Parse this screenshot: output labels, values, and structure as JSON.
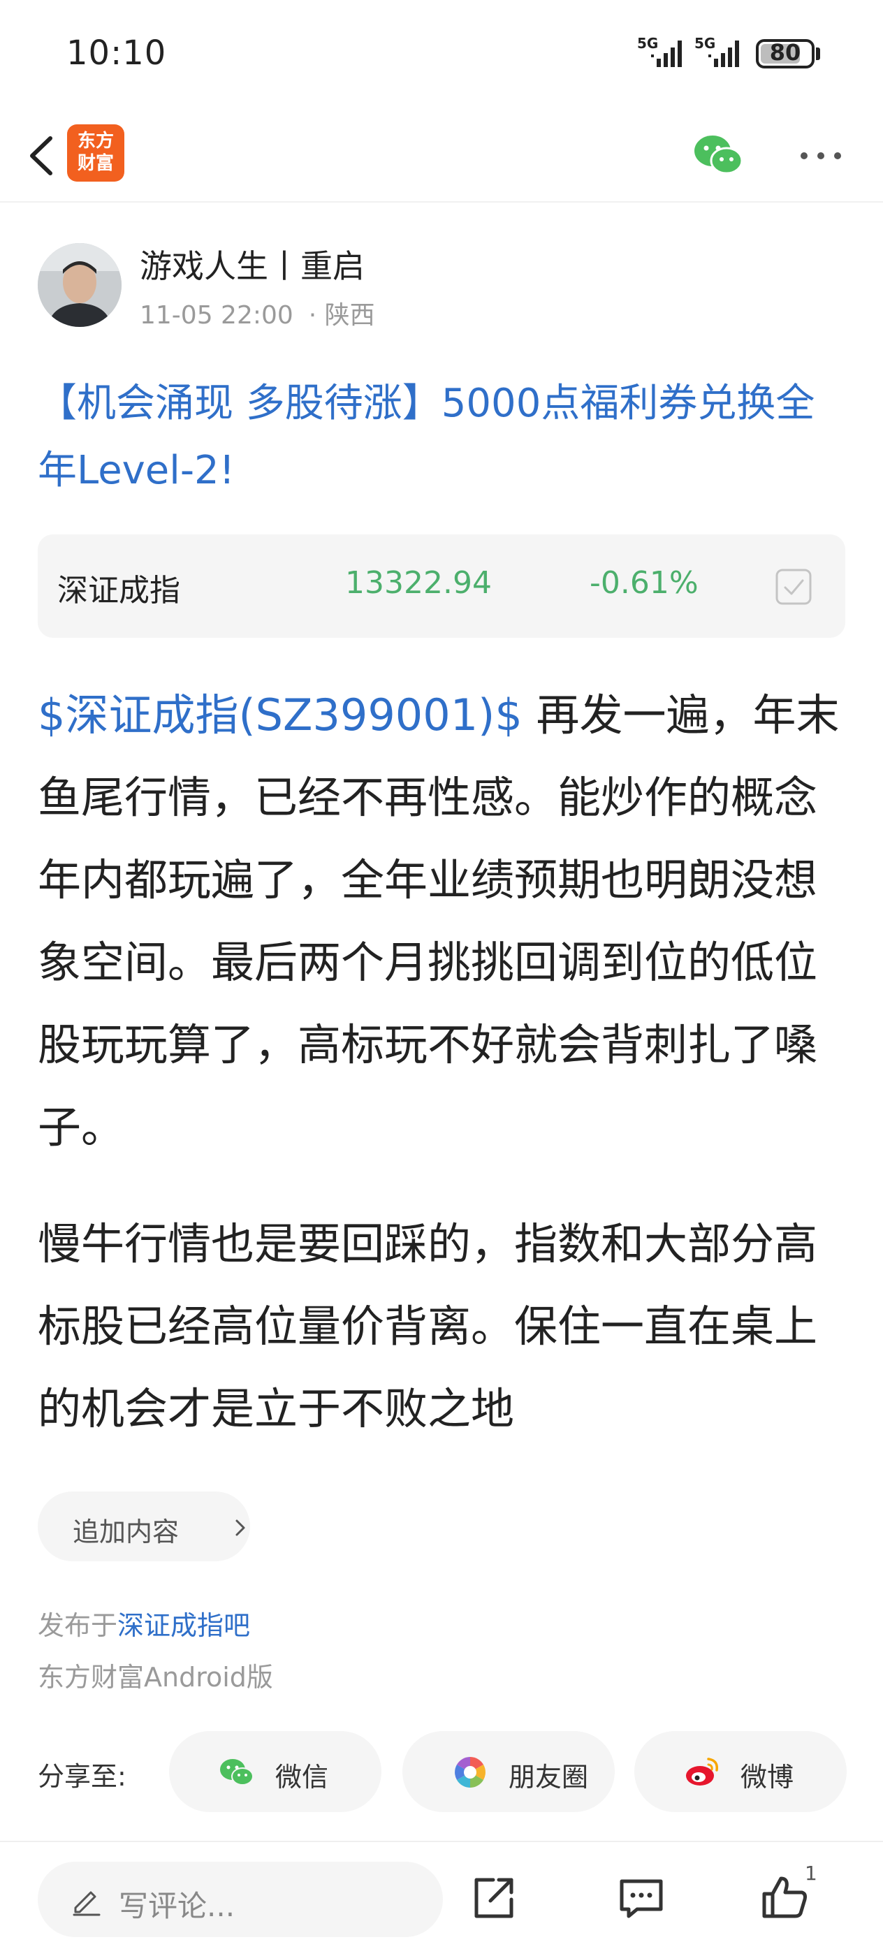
{
  "status_bar": {
    "time": "10:10",
    "signal_1": "5G",
    "signal_2": "5G",
    "battery": "80",
    "battery_level": 0.8
  },
  "nav": {
    "app_logo_line1": "东方",
    "app_logo_line2": "财富",
    "icons": [
      "back-icon",
      "wechat-icon",
      "more-icon"
    ]
  },
  "post": {
    "author": "游戏人生丨重启",
    "time": "11-05 22:00",
    "location": "· 陕西",
    "title": "【机会涌现 多股待涨】5000点福利券兑换全年Level-2!",
    "stock_card": {
      "name": "深证成指",
      "price": "13322.94",
      "change": "-0.61%",
      "color": "#4caf6c"
    },
    "paragraph1_link": "$深证成指(SZ399001)$",
    "paragraph1_text": " 再发一遍，年末鱼尾行情，已经不再性感。能炒作的概念年内都玩遍了，全年业绩预期也明朗没想象空间。最后两个月挑挑回调到位的低位股玩玩算了，高标玩不好就会背刺扎了嗓子。",
    "paragraph2_text": "慢牛行情也是要回踩的，指数和大部分高标股已经高位量价背离。保住一直在桌上的机会才是立于不败之地",
    "add_content": "追加内容",
    "published_prefix": "发布于",
    "published_bar": "深证成指吧",
    "client": "东方财富Android版"
  },
  "share": {
    "label": "分享至:",
    "buttons": [
      {
        "label": "微信",
        "icon": "wechat-icon"
      },
      {
        "label": "朋友圈",
        "icon": "moments-icon"
      },
      {
        "label": "微博",
        "icon": "weibo-icon"
      }
    ]
  },
  "bottom": {
    "comment_placeholder": "写评论...",
    "like_count": "1",
    "icons": [
      "pen-icon",
      "share-out-icon",
      "comment-icon",
      "thumb-up-icon"
    ]
  },
  "colors": {
    "link": "#2f6fc9",
    "brand": "#f2601f",
    "down": "#4caf6c"
  }
}
